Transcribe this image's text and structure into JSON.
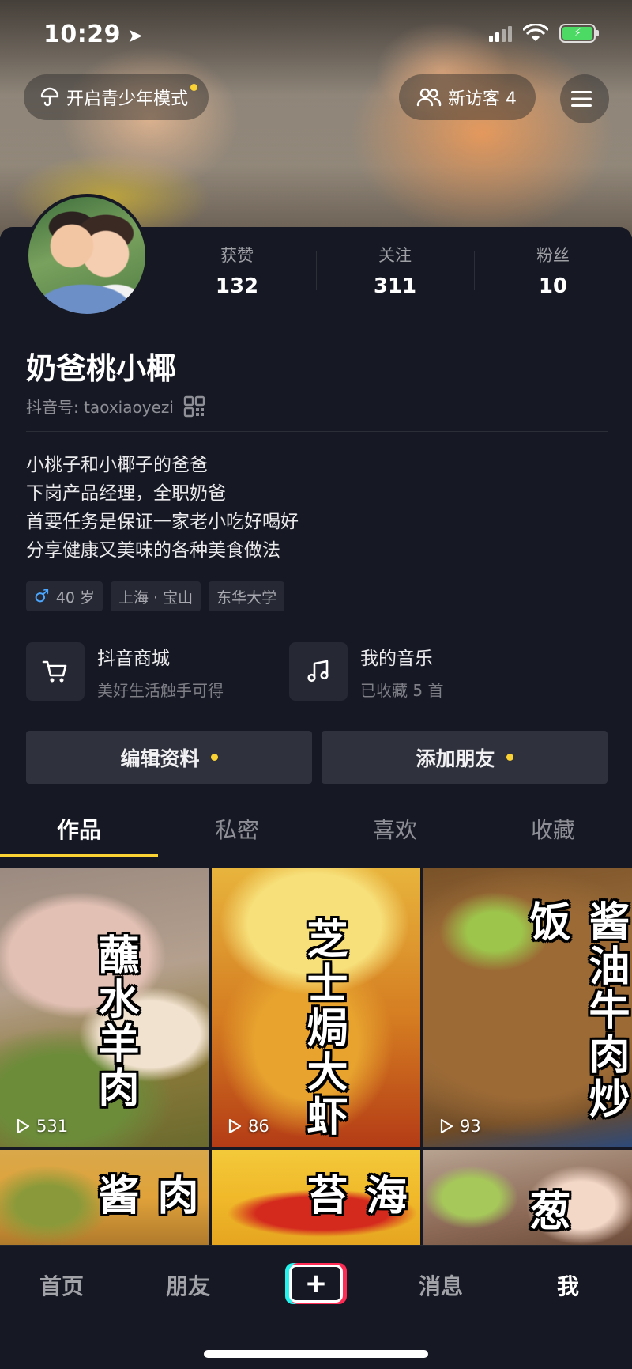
{
  "status_bar": {
    "time": "10:29"
  },
  "header": {
    "teen_mode_label": "开启青少年模式",
    "visitors_label": "新访客 4"
  },
  "profile": {
    "stats": [
      {
        "label": "获赞",
        "value": "132"
      },
      {
        "label": "关注",
        "value": "311"
      },
      {
        "label": "粉丝",
        "value": "10"
      }
    ],
    "name": "奶爸桃小椰",
    "douyin_id": "抖音号: taoxiaoyezi",
    "bio": [
      "小桃子和小椰子的爸爸",
      "下岗产品经理，全职奶爸",
      "首要任务是保证一家老小吃好喝好",
      "分享健康又美味的各种美食做法"
    ],
    "tags": {
      "age": "40 岁",
      "location": "上海 · 宝山",
      "school": "东华大学"
    },
    "features": [
      {
        "title": "抖音商城",
        "subtitle": "美好生活触手可得",
        "icon": "cart-icon"
      },
      {
        "title": "我的音乐",
        "subtitle": "已收藏 5 首",
        "icon": "music-note-icon"
      }
    ],
    "actions": {
      "edit": "编辑资料",
      "add_friend": "添加朋友"
    }
  },
  "tabs": [
    "作品",
    "私密",
    "喜欢",
    "收藏"
  ],
  "videos": [
    {
      "title": "蘸水羊肉",
      "plays": "531"
    },
    {
      "title": "芝士焗大虾",
      "plays": "86"
    },
    {
      "title": "酱油牛肉炒饭",
      "plays": "93"
    },
    {
      "title": "肉酱",
      "plays": ""
    },
    {
      "title": "海苔",
      "plays": ""
    },
    {
      "title": "葱",
      "plays": ""
    }
  ],
  "bottom_nav": {
    "home": "首页",
    "friends": "朋友",
    "messages": "消息",
    "me": "我"
  },
  "colors": {
    "accent": "#fbd233",
    "background": "#161823",
    "male": "#4aa6ff"
  }
}
